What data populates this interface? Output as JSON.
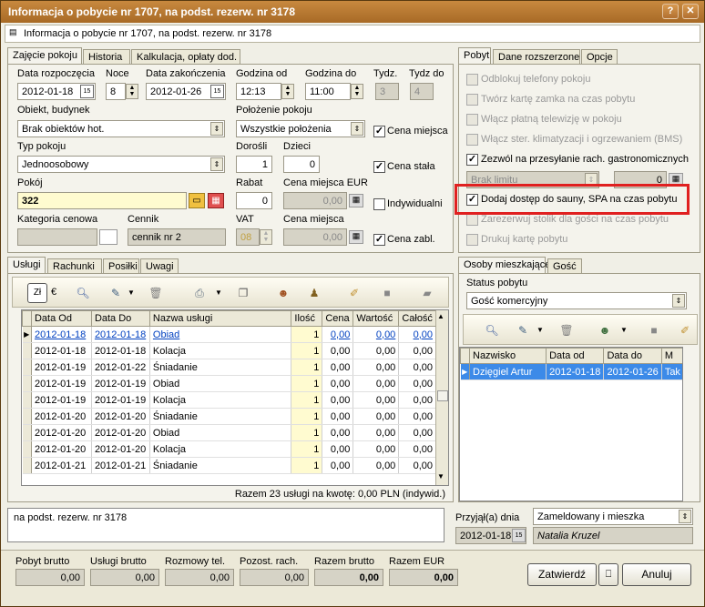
{
  "window": {
    "title": "Informacja o pobycie nr 1707, na podst. rezerw. nr 3178",
    "info": "Informacja o pobycie nr 1707, na podst. rezerw. nr 3178"
  },
  "left_tabs": [
    "Zajęcie pokoju",
    "Historia",
    "Kalkulacja, opłaty dod."
  ],
  "right_tabs": [
    "Pobyt",
    "Dane rozszerzone",
    "Opcje"
  ],
  "zajecie": {
    "data_rozp_label": "Data rozpoczęcia",
    "data_rozp": "2012-01-18",
    "noce_label": "Noce",
    "noce": "8",
    "data_zak_label": "Data zakończenia",
    "data_zak": "2012-01-26",
    "godz_od_label": "Godzina od",
    "godz_od": "12:13",
    "godz_do_label": "Godzina do",
    "godz_do": "11:00",
    "tydz_label": "Tydz.",
    "tydz": "3",
    "tydz_do_label": "Tydz do",
    "tydz_do": "4",
    "obiekt_label": "Obiekt, budynek",
    "obiekt": "Brak obiektów hot.",
    "polozenie_label": "Położenie pokoju",
    "polozenie": "Wszystkie położenia",
    "cena_miejsca_chk": "Cena miejsca",
    "typ_label": "Typ pokoju",
    "typ": "Jednoosobowy",
    "dorosli_label": "Dorośli",
    "dorosli": "1",
    "dzieci_label": "Dzieci",
    "dzieci": "0",
    "cena_stala_chk": "Cena stała",
    "pokoj_label": "Pokój",
    "pokoj": "322",
    "rabat_label": "Rabat",
    "rabat": "0",
    "cena_eur_label": "Cena miejsca EUR",
    "cena_eur": "0,00",
    "indywidualni_chk": "Indywidualni",
    "kategoria_label": "Kategoria cenowa",
    "cennik_label": "Cennik",
    "cennik": "cennik nr 2",
    "vat_label": "VAT",
    "vat": "08",
    "cena_miejsca_label": "Cena miejsca",
    "cena_miejsca": "0,00",
    "cena_zabl_chk": "Cena zabl."
  },
  "pobyt_opts": [
    {
      "label": "Odblokuj telefony pokoju",
      "checked": false,
      "enabled": false
    },
    {
      "label": "Twórz kartę zamka na czas pobytu",
      "checked": false,
      "enabled": false
    },
    {
      "label": "Włącz płatną telewizję w pokoju",
      "checked": false,
      "enabled": false
    },
    {
      "label": "Włącz ster. klimatyzacji i ogrzewaniem (BMS)",
      "checked": false,
      "enabled": false
    },
    {
      "label": "Zezwól na przesyłanie rach. gastronomicznych",
      "checked": true,
      "enabled": true
    }
  ],
  "limit": {
    "value": "Brak limitu",
    "amount": "0"
  },
  "pobyt_opts2": [
    {
      "label": "Dodaj dostęp do sauny, SPA na czas pobytu",
      "checked": true,
      "enabled": true
    },
    {
      "label": "Zarezerwuj stolik dla gości na czas pobytu",
      "checked": false,
      "enabled": false
    },
    {
      "label": "Drukuj kartę pobytu",
      "checked": false,
      "enabled": false
    }
  ],
  "services_tabs": [
    "Usługi",
    "Rachunki",
    "Posiłki",
    "Uwagi"
  ],
  "services": {
    "currency_label": "Zł",
    "currency_alt": "€",
    "columns": [
      "Data Od",
      "Data Do",
      "Nazwa usługi",
      "Ilość",
      "Cena",
      "Wartość",
      "Całość"
    ],
    "rows": [
      [
        "2012-01-18",
        "2012-01-18",
        "Obiad",
        "1",
        "0,00",
        "0,00",
        "0,00"
      ],
      [
        "2012-01-18",
        "2012-01-18",
        "Kolacja",
        "1",
        "0,00",
        "0,00",
        "0,00"
      ],
      [
        "2012-01-19",
        "2012-01-22",
        "Śniadanie",
        "1",
        "0,00",
        "0,00",
        "0,00"
      ],
      [
        "2012-01-19",
        "2012-01-19",
        "Obiad",
        "1",
        "0,00",
        "0,00",
        "0,00"
      ],
      [
        "2012-01-19",
        "2012-01-19",
        "Kolacja",
        "1",
        "0,00",
        "0,00",
        "0,00"
      ],
      [
        "2012-01-20",
        "2012-01-20",
        "Śniadanie",
        "1",
        "0,00",
        "0,00",
        "0,00"
      ],
      [
        "2012-01-20",
        "2012-01-20",
        "Obiad",
        "1",
        "0,00",
        "0,00",
        "0,00"
      ],
      [
        "2012-01-20",
        "2012-01-20",
        "Kolacja",
        "1",
        "0,00",
        "0,00",
        "0,00"
      ],
      [
        "2012-01-21",
        "2012-01-21",
        "Śniadanie",
        "1",
        "0,00",
        "0,00",
        "0,00"
      ]
    ],
    "footer": "Razem 23 usługi na kwotę: 0,00 PLN (indywid.)"
  },
  "guests_tabs": [
    "Osoby mieszkające",
    "Gość"
  ],
  "guests": {
    "status_label": "Status pobytu",
    "status": "Gość komercyjny",
    "columns": [
      "Nazwisko",
      "Data od",
      "Data do",
      "M"
    ],
    "rows": [
      [
        "Dzięgiel Artur",
        "2012-01-18",
        "2012-01-26",
        "Tak"
      ]
    ]
  },
  "notes": "na podst. rezerw. nr 3178",
  "przyjal": {
    "label": "Przyjął(a) dnia",
    "date": "2012-01-18",
    "status": "Zameldowany i mieszka",
    "person": "Natalia Kruzel"
  },
  "totals": [
    {
      "label": "Pobyt brutto",
      "value": "0,00"
    },
    {
      "label": "Usługi brutto",
      "value": "0,00"
    },
    {
      "label": "Rozmowy tel.",
      "value": "0,00"
    },
    {
      "label": "Pozost. rach.",
      "value": "0,00"
    },
    {
      "label": "Razem brutto",
      "value": "0,00"
    },
    {
      "label": "Razem EUR",
      "value": "0,00"
    }
  ],
  "buttons": {
    "ok": "Zatwierdź",
    "cancel": "Anuluj"
  }
}
